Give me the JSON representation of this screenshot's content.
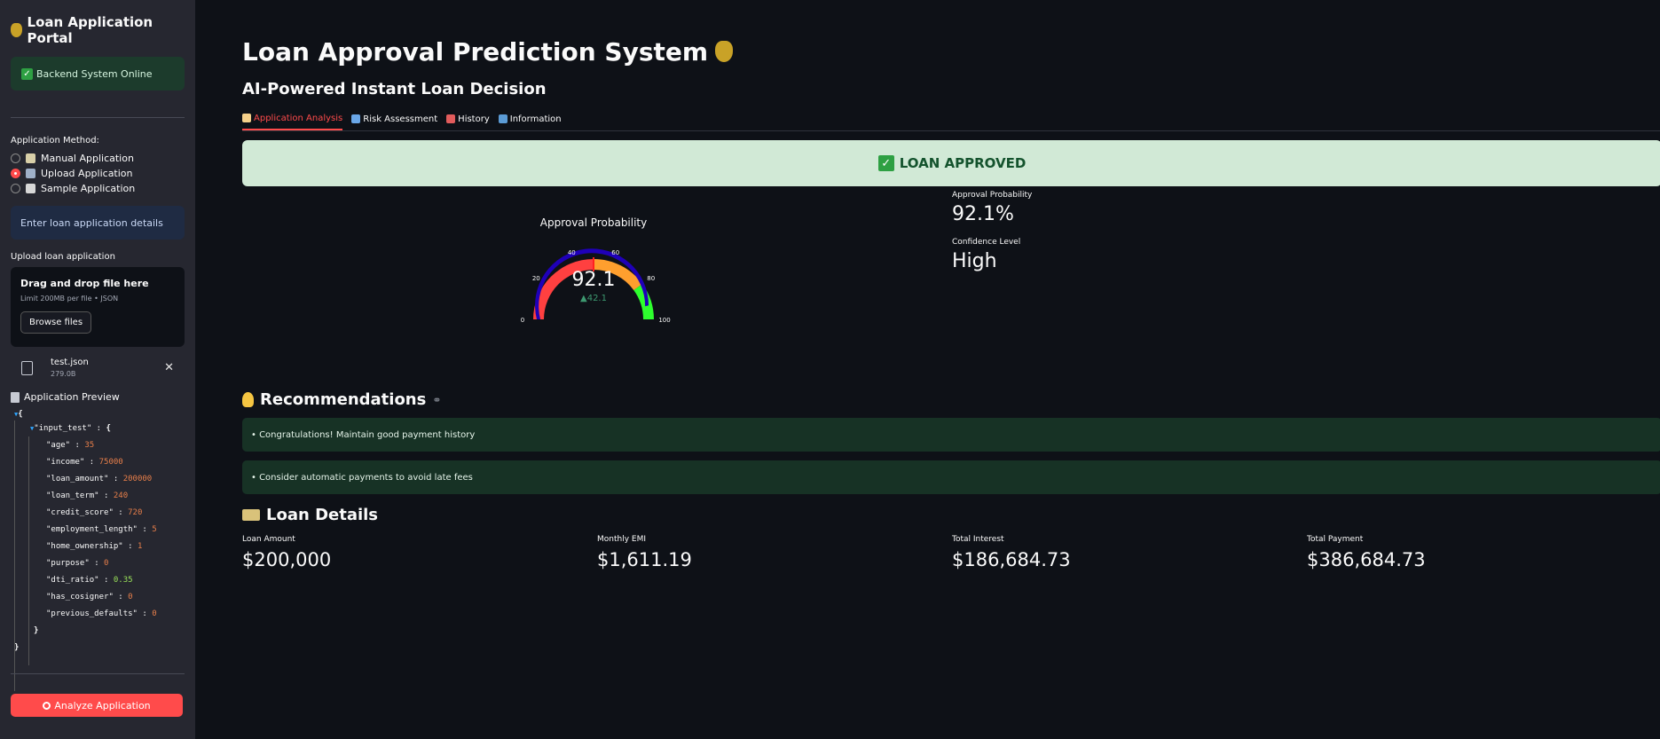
{
  "sidebar": {
    "title": "Loan Application Portal",
    "status": "Backend System Online",
    "method_label": "Application Method:",
    "methods": [
      {
        "label": "Manual Application",
        "selected": false
      },
      {
        "label": "Upload Application",
        "selected": true
      },
      {
        "label": "Sample Application",
        "selected": false
      }
    ],
    "info": "Enter loan application details",
    "upload_label": "Upload loan application",
    "dropzone_title": "Drag and drop file here",
    "dropzone_sub": "Limit 200MB per file • JSON",
    "browse": "Browse files",
    "file_name": "test.json",
    "file_size": "279.0B",
    "preview_title": "Application Preview",
    "json_root_key": "\"input_test\"",
    "json_fields": [
      {
        "key": "\"age\"",
        "value": "35",
        "type": "num"
      },
      {
        "key": "\"income\"",
        "value": "75000",
        "type": "num"
      },
      {
        "key": "\"loan_amount\"",
        "value": "200000",
        "type": "num"
      },
      {
        "key": "\"loan_term\"",
        "value": "240",
        "type": "num"
      },
      {
        "key": "\"credit_score\"",
        "value": "720",
        "type": "num"
      },
      {
        "key": "\"employment_length\"",
        "value": "5",
        "type": "num"
      },
      {
        "key": "\"home_ownership\"",
        "value": "1",
        "type": "num"
      },
      {
        "key": "\"purpose\"",
        "value": "0",
        "type": "num"
      },
      {
        "key": "\"dti_ratio\"",
        "value": "0.35",
        "type": "float"
      },
      {
        "key": "\"has_cosigner\"",
        "value": "0",
        "type": "num"
      },
      {
        "key": "\"previous_defaults\"",
        "value": "0",
        "type": "num"
      }
    ],
    "analyze": "Analyze Application"
  },
  "main": {
    "title": "Loan Approval Prediction System",
    "subtitle": "AI-Powered Instant Loan Decision",
    "tabs": [
      {
        "label": "Application Analysis",
        "active": true,
        "color": "#f5d08a"
      },
      {
        "label": "Risk Assessment",
        "active": false,
        "color": "#6aa7e8"
      },
      {
        "label": "History",
        "active": false,
        "color": "#e25c5c"
      },
      {
        "label": "Information",
        "active": false,
        "color": "#5b9bd5"
      }
    ],
    "decision": "LOAN APPROVED",
    "gauge": {
      "title": "Approval Probability",
      "value": "92.1",
      "delta": "▲42.1",
      "ticks": [
        "0",
        "20",
        "40",
        "60",
        "80",
        "100"
      ],
      "fraction": 0.921
    },
    "metrics": [
      {
        "label": "Approval Probability",
        "value": "92.1%"
      },
      {
        "label": "Confidence Level",
        "value": "High"
      }
    ],
    "recommendations_title": "Recommendations",
    "recommendations": [
      "• Congratulations! Maintain good payment history",
      "• Consider automatic payments to avoid late fees"
    ],
    "loan_details_title": "Loan Details",
    "loan_details": [
      {
        "label": "Loan Amount",
        "value": "$200,000"
      },
      {
        "label": "Monthly EMI",
        "value": "$1,611.19"
      },
      {
        "label": "Total Interest",
        "value": "$186,684.73"
      },
      {
        "label": "Total Payment",
        "value": "$386,684.73"
      }
    ]
  },
  "colors": {
    "accent": "#ff4b4b",
    "success_bg": "#d1e9d6",
    "gauge_bar": "#1f00b8",
    "gauge_band_low": "#ff4040",
    "gauge_band_mid": "#ff9f2e",
    "gauge_band_high": "#2eff2e"
  }
}
